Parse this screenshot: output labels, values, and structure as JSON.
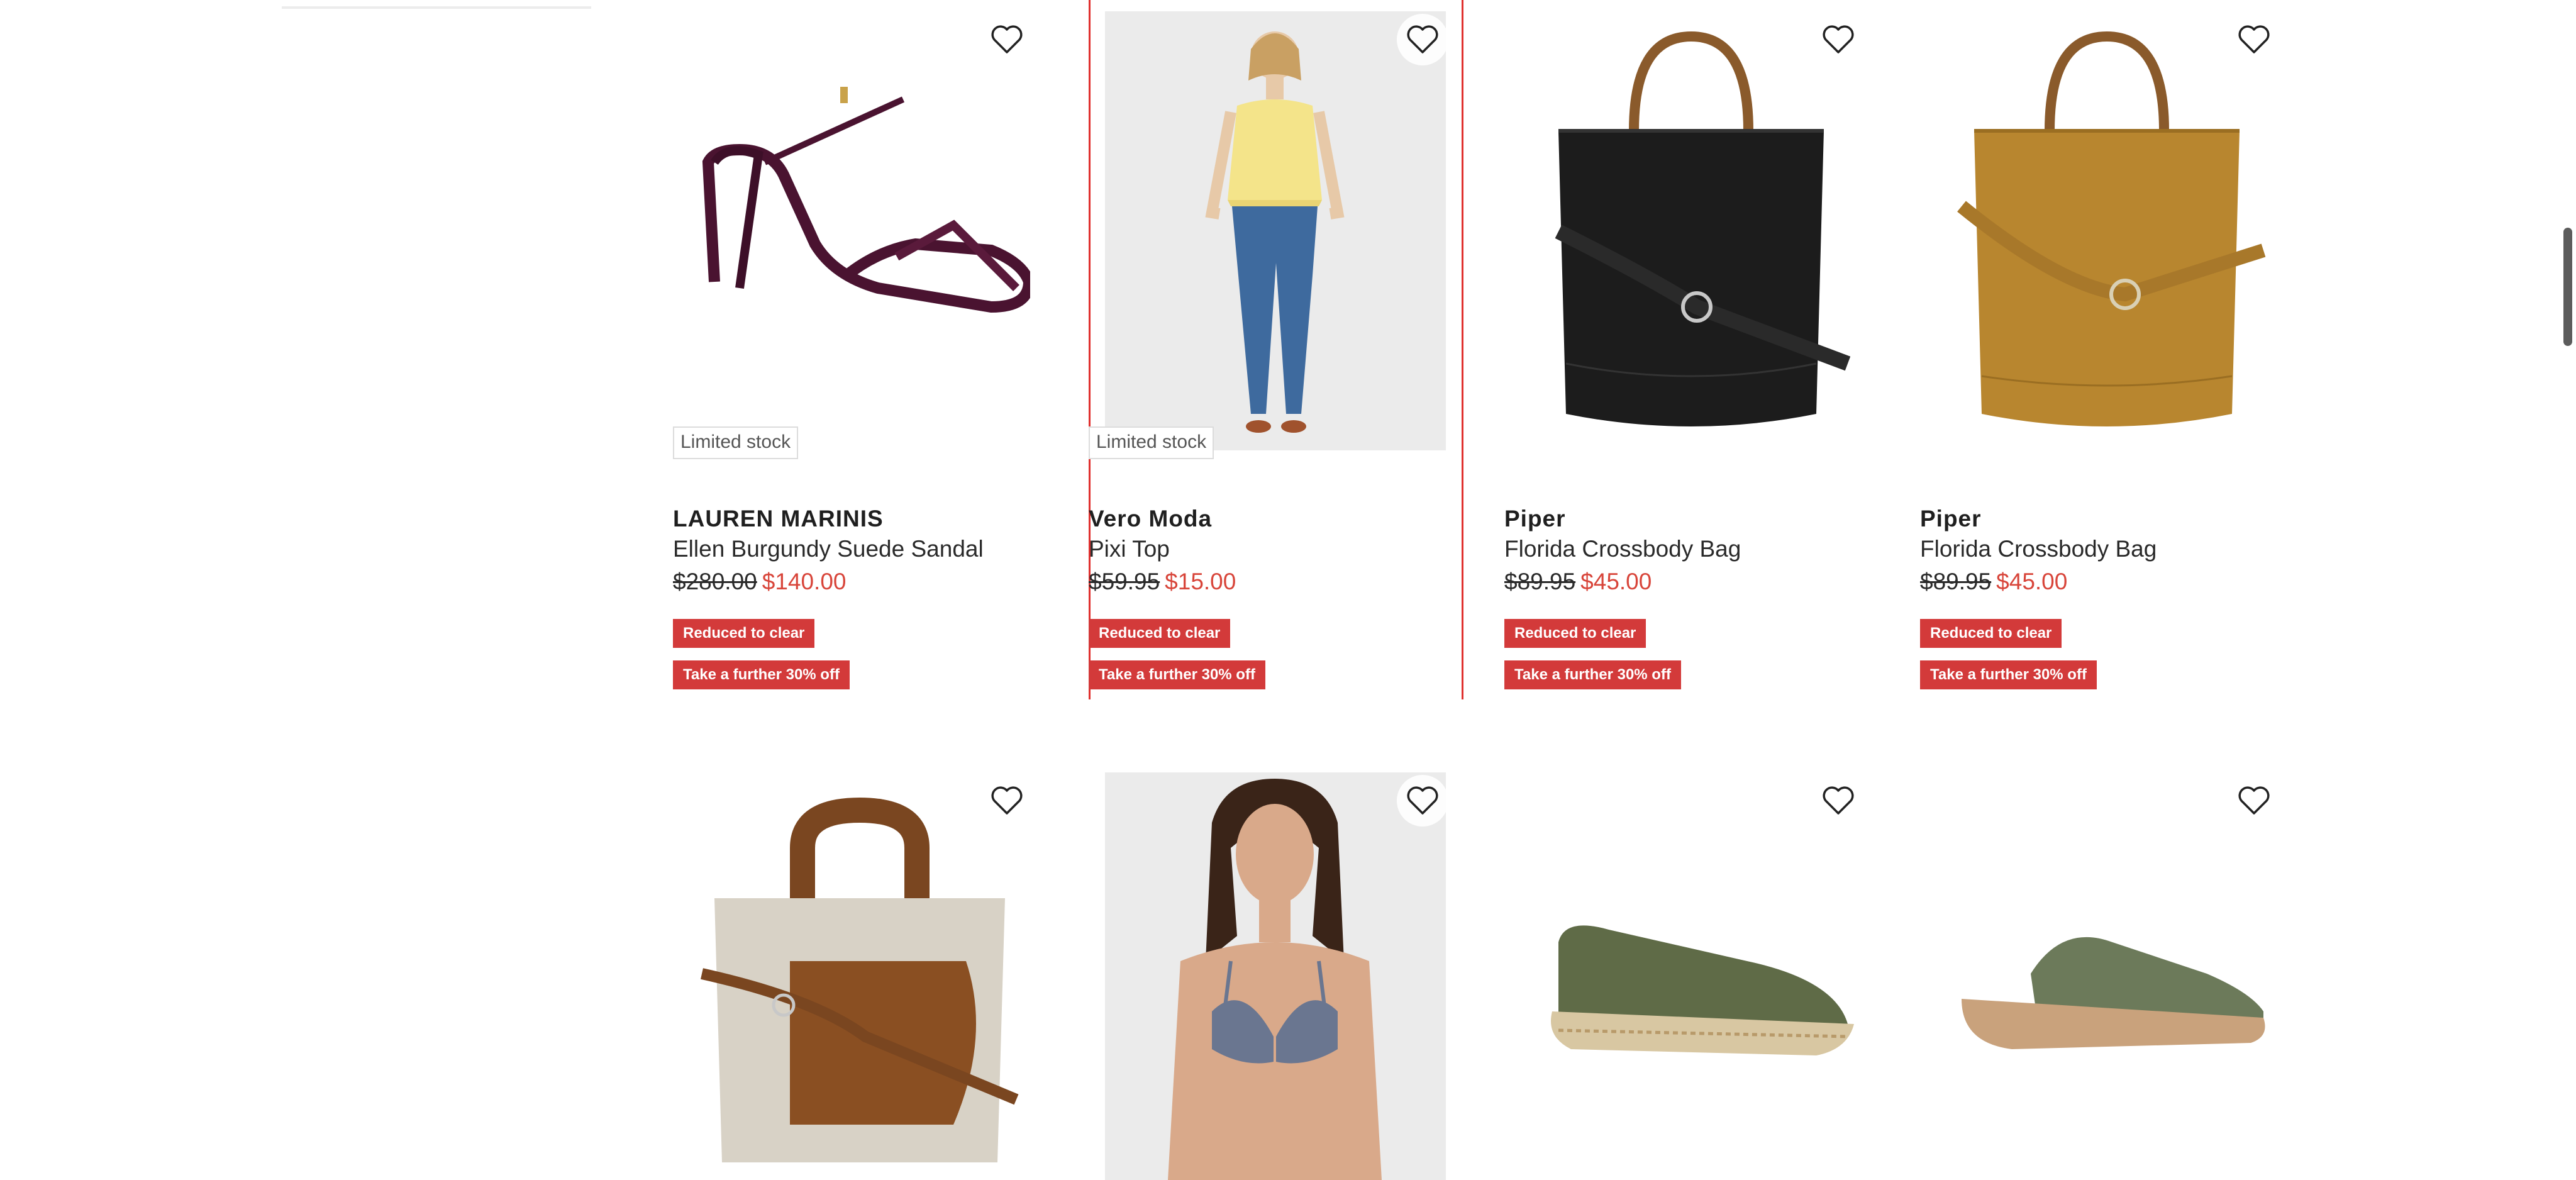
{
  "products": [
    {
      "brand": "LAUREN MARINIS",
      "name": "Ellen Burgundy Suede Sandal",
      "was": "$280.00",
      "now": "$140.00",
      "stock": "Limited stock",
      "tag1": "Reduced to clear",
      "tag2": "Take a further 30% off"
    },
    {
      "brand": "Vero Moda",
      "name": "Pixi Top",
      "was": "$59.95",
      "now": "$15.00",
      "stock": "Limited stock",
      "tag1": "Reduced to clear",
      "tag2": "Take a further 30% off"
    },
    {
      "brand": "Piper",
      "name": "Florida Crossbody Bag",
      "was": "$89.95",
      "now": "$45.00",
      "tag1": "Reduced to clear",
      "tag2": "Take a further 30% off"
    },
    {
      "brand": "Piper",
      "name": "Florida Crossbody Bag",
      "was": "$89.95",
      "now": "$45.00",
      "tag1": "Reduced to clear",
      "tag2": "Take a further 30% off"
    }
  ],
  "icons": {
    "wishlist": "heart-outline-icon"
  },
  "colors": {
    "sale_price": "#d8453a",
    "badge": "#d33a3a",
    "focus_outline": "#e0312f"
  }
}
